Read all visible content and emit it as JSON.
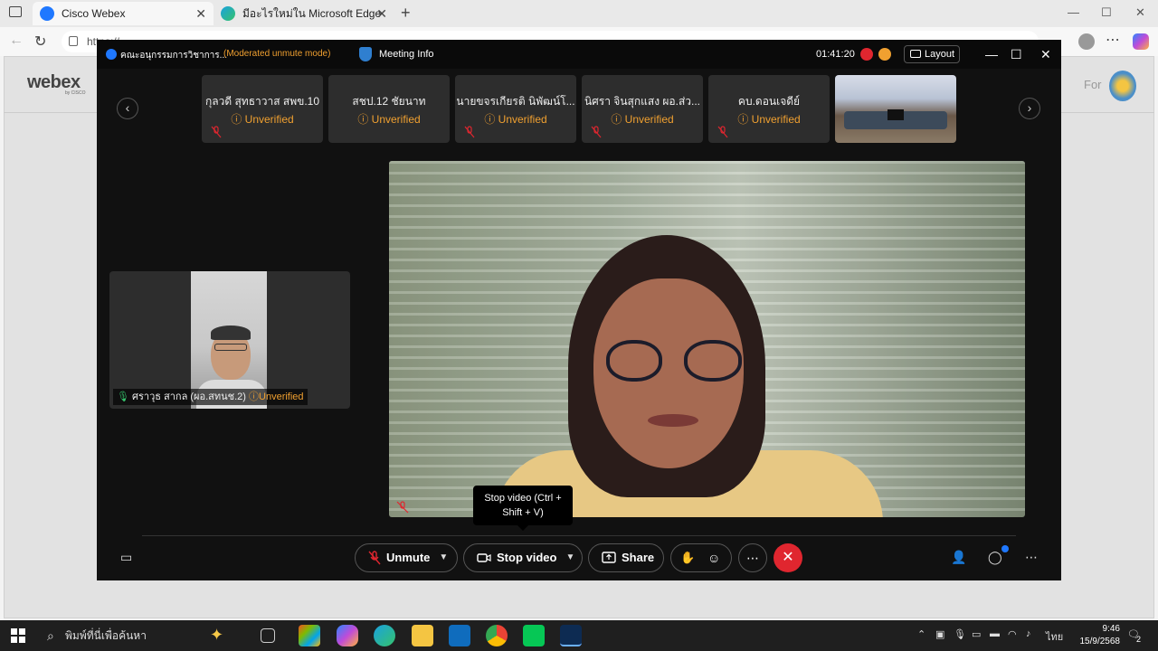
{
  "browser": {
    "tabs": [
      {
        "title": "Cisco Webex"
      },
      {
        "title": "มีอะไรใหม่ใน Microsoft Edge"
      }
    ],
    "url": "https://..."
  },
  "webex_page": {
    "logo": "webex",
    "logo_sub": "by CISCO",
    "right_text": "For"
  },
  "meeting": {
    "title": "คณะอนุกรรมการวิชาการ...",
    "mode": "(Moderated unmute mode)",
    "info_label": "Meeting Info",
    "timer": "01:41:20",
    "layout_label": "Layout",
    "participants": [
      {
        "name": "กุลวดี สุทธาวาส สพข.10",
        "status": "Unverified"
      },
      {
        "name": "สชป.12 ชัยนาท",
        "status": "Unverified"
      },
      {
        "name": "นายขจรเกียรติ นิพัฒน์โ...",
        "status": "Unverified"
      },
      {
        "name": "นิศรา จินสุกแสง ผอ.ส่ว...",
        "status": "Unverified"
      },
      {
        "name": "คบ.ดอนเจดีย์",
        "status": "Unverified"
      }
    ],
    "self_view": {
      "name": "ศราวุธ สากล (ผอ.สทนช.2)",
      "status": "Unverified"
    },
    "tooltip": "Stop video (Ctrl + Shift + V)",
    "controls": {
      "unmute": "Unmute",
      "stop_video": "Stop video",
      "share": "Share"
    }
  },
  "taskbar": {
    "search_placeholder": "พิมพ์ที่นี่เพื่อค้นหา",
    "language": "ไทย",
    "time": "9:46",
    "date": "15/9/2568",
    "notifications": "2"
  },
  "colors": {
    "accent_orange": "#f0a030",
    "end_red": "#e0262f",
    "webex_blue": "#1f78ff"
  }
}
